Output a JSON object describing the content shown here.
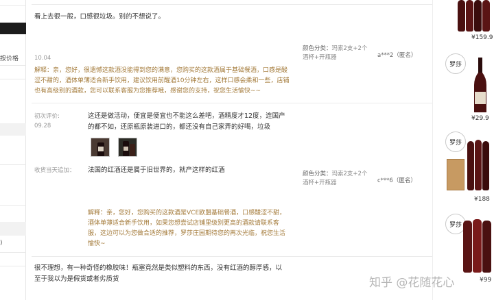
{
  "sidebar": {
    "price_fragment": "按价格",
    "bottom_fragment": ")"
  },
  "reviews": [
    {
      "text": "看上去很一般，口感很垃圾。别的不想说了。",
      "date": "10.04",
      "variant_label": "颜色分类：",
      "variant_value": "玛索2支+2个酒杯+开瓶器",
      "user": "a***2（匿名）",
      "reply": "解释：亲，您好，很遗憾这款酒没能得到您的满意，您购买的这款酒属于基础餐酒，口感是酸涩不甜的，酒体单薄适合新手饮用，建议饮用前醒酒10分钟左右，这样口感会柔和一些，店铺也有高级别的酒款，您可以联系客服为您推荐哦，感谢您的支持，祝您生活愉快~~"
    },
    {
      "first_label": "初次评价:",
      "date": "09.28",
      "text": "这还是做活动，便宜是便宜也不能这么差吧，酒精度才12度，连国产的都不如，还原瓶原装进口的，都还没有自己家弄的好喝，垃圾",
      "followup_label": "收货当天追加：",
      "followup_text": "法国的红酒还是属于旧世界的，就产这样的红酒",
      "variant_label": "颜色分类：",
      "variant_value": "玛索2支+2个酒杯+开瓶器",
      "user": "c***6（匿名）",
      "reply": "解释：亲，您好，您购买的这款酒是VCE欧盟基础餐酒，口感酸涩不甜，酒体单薄适合新手饮用，如果您想尝试店铺里级别更高的酒款请联系客服，这边可以为您做合适的推荐，罗莎庄园期待您的再次光临，祝您生活愉快~"
    },
    {
      "text": "很不理想，有一种奇怪的橡胶味！瓶塞竟然是类似塑料的东西，没有红酒的醇厚感，以至于我以为是假货或者劣质货"
    }
  ],
  "products": [
    {
      "price": "¥159.9"
    },
    {
      "price": "¥29.9",
      "seal": "罗莎"
    },
    {
      "price": "¥188",
      "seal": "罗莎"
    },
    {
      "price": "¥99",
      "seal": "罗莎"
    }
  ],
  "watermark": "知乎 @花随花心",
  "colors": {
    "reply": "#a47b3b",
    "wine": "#5a1414",
    "box": "#c79a62"
  }
}
